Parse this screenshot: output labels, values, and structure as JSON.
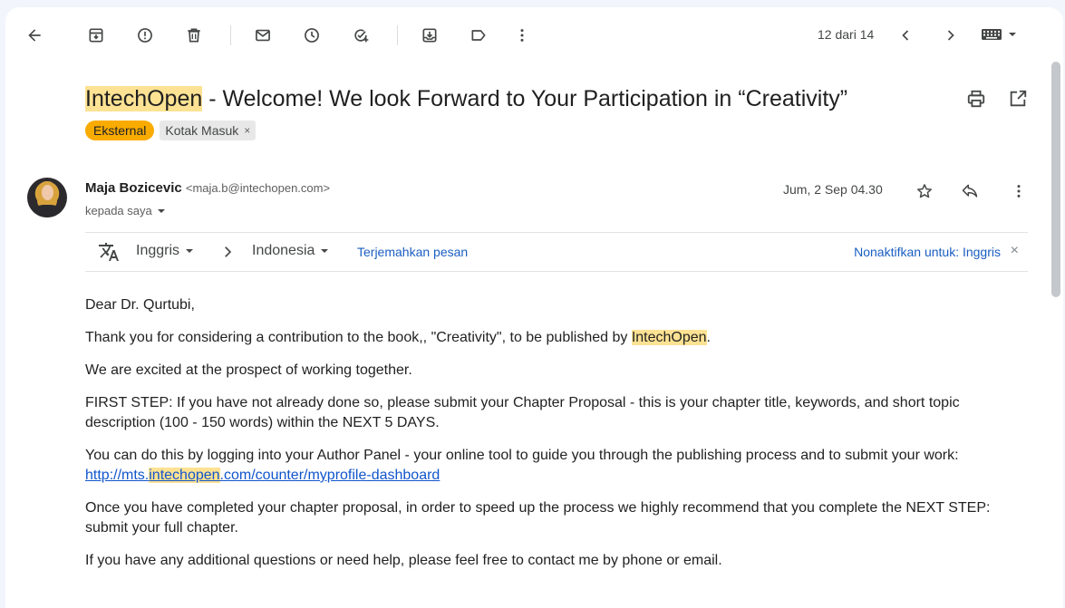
{
  "toolbar": {
    "pager": "12 dari 14"
  },
  "subject": {
    "brand": "IntechOpen",
    "rest": " - Welcome! We look Forward to Your Participation in “Creativity”"
  },
  "labels": {
    "external": "Eksternal",
    "inbox": "Kotak Masuk",
    "remove": "×"
  },
  "message": {
    "sender_name": "Maja Bozicevic",
    "sender_email": "<maja.b@intechopen.com>",
    "recipient": "kepada saya",
    "date": "Jum, 2 Sep 04.30"
  },
  "translate": {
    "source_lang": "Inggris",
    "target_lang": "Indonesia",
    "translate_link": "Terjemahkan pesan",
    "disable_link": "Nonaktifkan untuk: Inggris",
    "close": "×"
  },
  "body": {
    "greeting": "Dear Dr. Qurtubi,",
    "p1_a": "Thank you for considering a contribution to the book,, \"Creativity\", to be published by ",
    "p1_brand": "IntechOpen",
    "p1_b": ".",
    "p2": "We are excited at the prospect of working together.",
    "p3": "FIRST STEP: If you have not already done so, please submit your Chapter Proposal - this is your chapter title, keywords, and short topic description (100 - 150 words) within the NEXT 5 DAYS.",
    "p4": "You can do this by logging into your Author Panel - your online tool to guide you through the publishing process and to submit your work:",
    "link_a": "http://mts.",
    "link_brand": "intechopen",
    "link_b": ".com/counter/myprofile-dashboard",
    "p5": "Once you have completed your chapter proposal, in order to speed up the process we highly recommend that you complete the NEXT STEP: submit your full chapter.",
    "p6": "If you have any additional questions or need help, please feel free to contact me by phone or email."
  },
  "colors": {
    "highlight": "#fde293",
    "external_chip": "#f9ab00",
    "link": "#1155cc"
  },
  "icons": [
    "back-arrow-icon",
    "archive-icon",
    "report-spam-icon",
    "delete-icon",
    "mark-unread-icon",
    "snooze-icon",
    "add-task-icon",
    "move-to-icon",
    "label-icon",
    "more-vert-icon",
    "chevron-left-icon",
    "chevron-right-icon",
    "keyboard-icon",
    "print-icon",
    "open-new-window-icon",
    "star-icon",
    "reply-icon",
    "translate-icon"
  ]
}
